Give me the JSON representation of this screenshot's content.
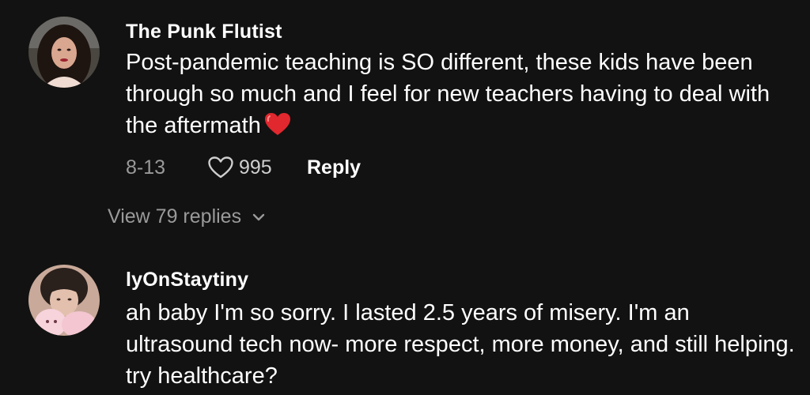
{
  "comments": [
    {
      "author": "The Punk Flutist",
      "text": "Post-pandemic teaching is SO different, these kids have been through so much and I feel for new teachers having to deal with the aftermath",
      "emoji_icon": "red-heart-emoji",
      "date": "8-13",
      "likes": "995",
      "reply_label": "Reply"
    },
    {
      "author": "lyOnStaytiny",
      "text": "ah baby I'm so sorry. I lasted 2.5 years of misery. I'm an ultrasound tech now- more respect, more money, and still helping. try healthcare?"
    }
  ],
  "view_replies": {
    "label": "View 79 replies",
    "icon": "chevron-down-icon"
  },
  "colors": {
    "background": "#121212",
    "text_primary": "#ffffff",
    "text_secondary": "#9a9a9a",
    "heart_emoji": "#e0282e"
  }
}
